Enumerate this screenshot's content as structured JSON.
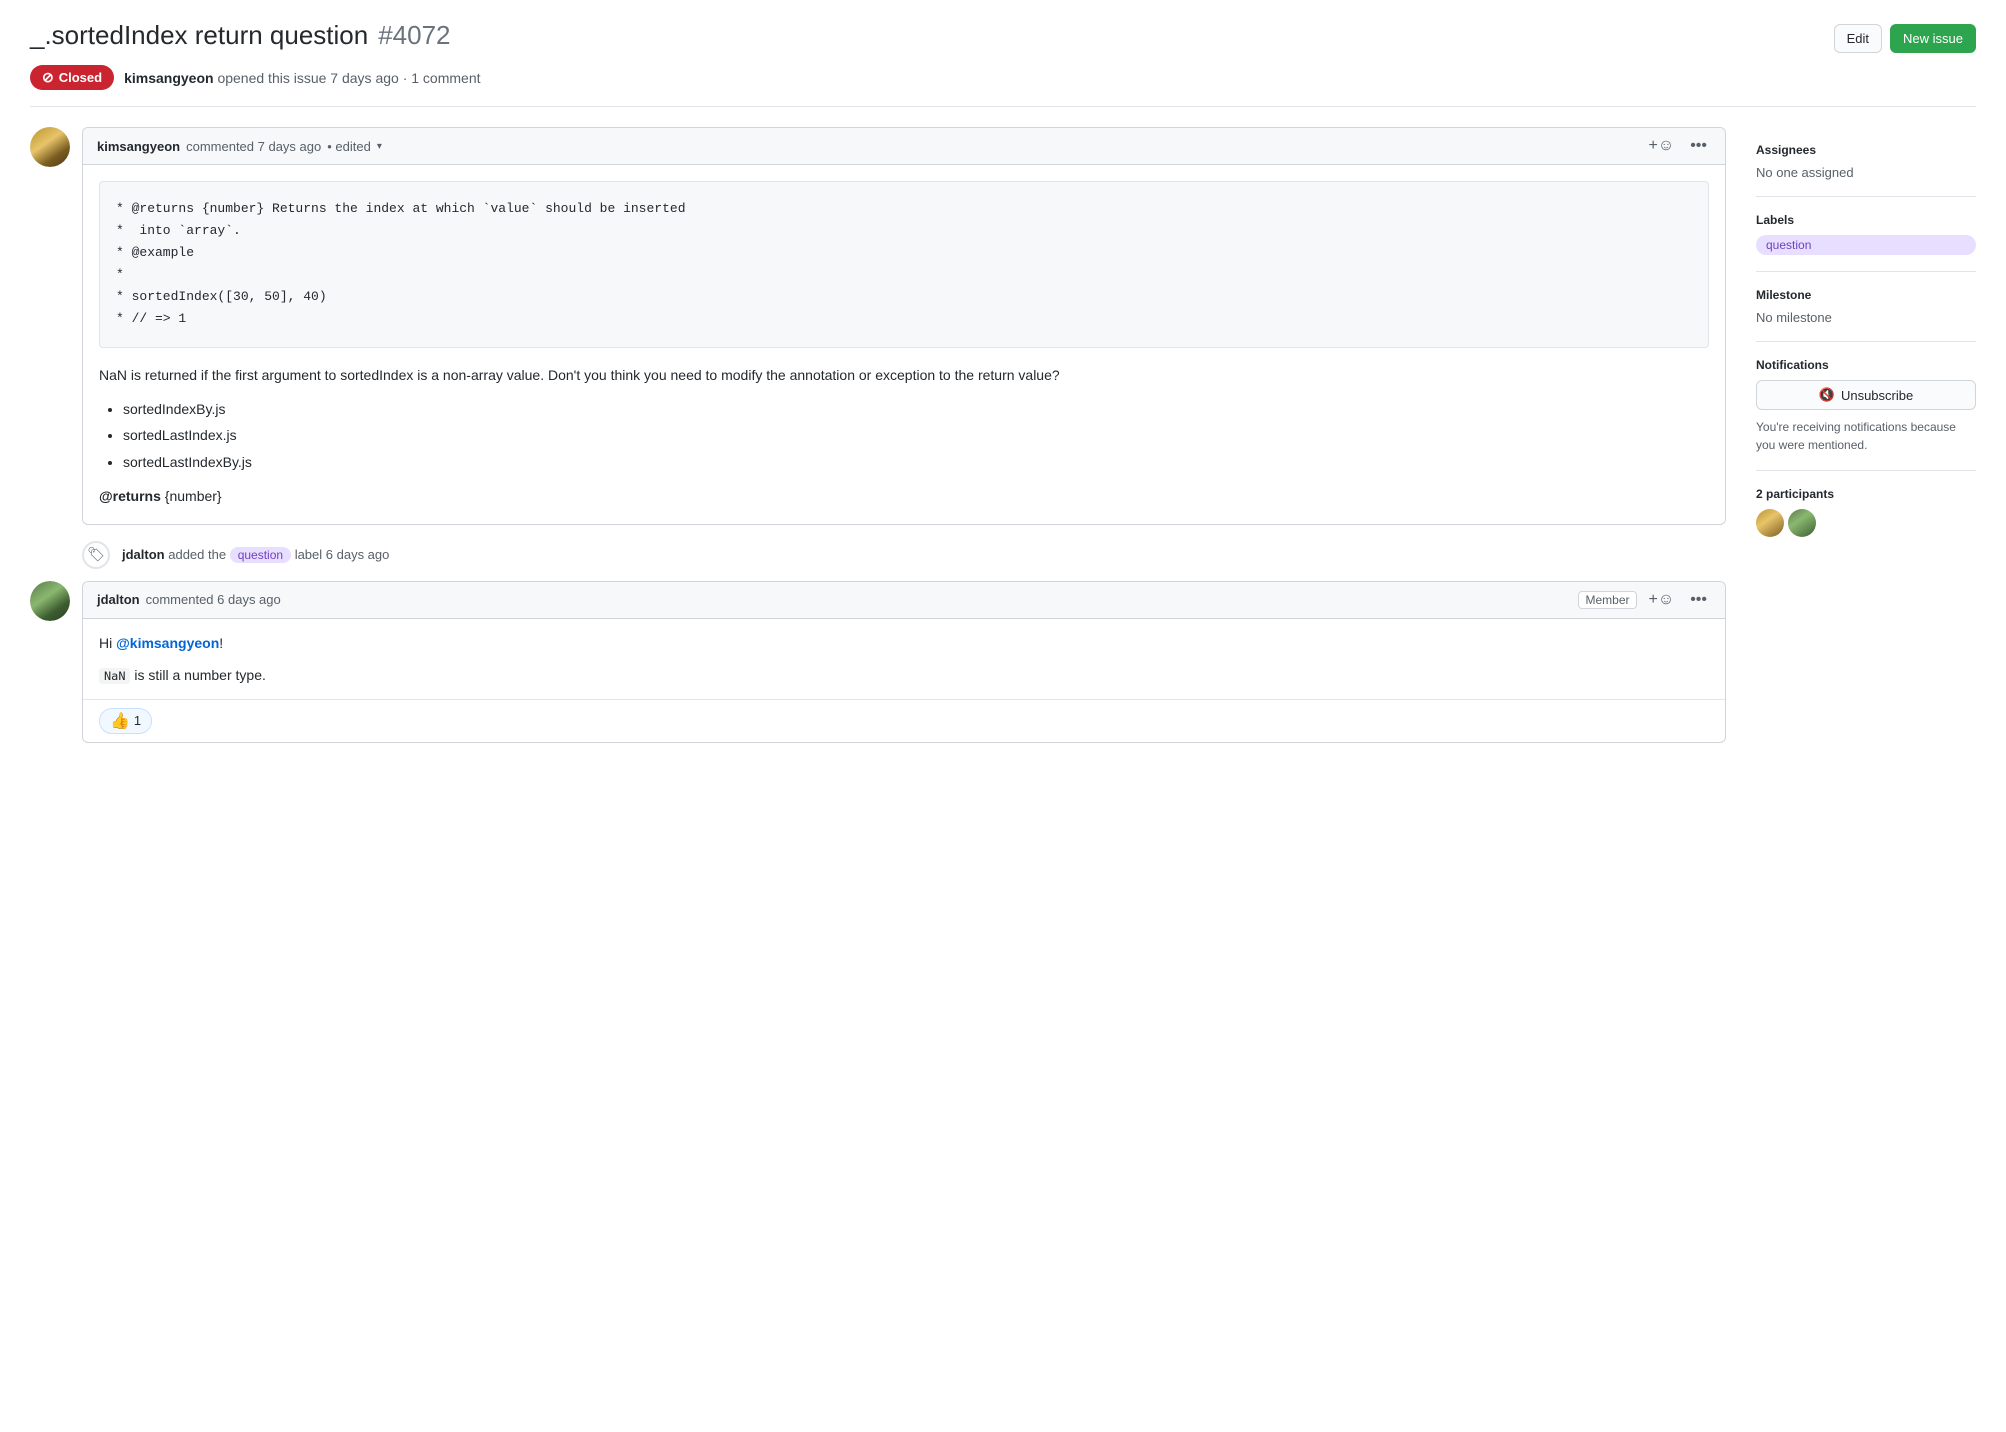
{
  "header": {
    "title": "_.sortedIndex return question",
    "issue_number": "#4072",
    "edit_label": "Edit",
    "new_issue_label": "New issue"
  },
  "status": {
    "badge": "Closed",
    "meta": "kimsangyeon opened this issue 7 days ago · 1 comment"
  },
  "first_comment": {
    "author": "kimsangyeon",
    "time": "commented 7 days ago",
    "edited": "• edited",
    "code_lines": [
      "* @returns {number} Returns the index at which `value` should be inserted",
      "*  into `array`.",
      "* @example",
      "*",
      "* sortedIndex([30, 50], 40)",
      "* // => 1"
    ],
    "body_text": "NaN is returned if the first argument to sortedIndex is a non-array value. Don't you think you need to modify the annotation or exception to the return value?",
    "bullets": [
      "sortedIndexBy.js",
      "sortedLastIndex.js",
      "sortedLastIndexBy.js"
    ],
    "returns_line_bold": "@returns",
    "returns_line_rest": " {number}"
  },
  "timeline_event": {
    "author": "jdalton",
    "action": "added the",
    "label": "question",
    "suffix": "label 6 days ago"
  },
  "second_comment": {
    "author": "jdalton",
    "time": "commented 6 days ago",
    "member_badge": "Member",
    "greeting": "Hi ",
    "mention": "@kimsangyeon",
    "greeting_end": "!",
    "body_part1": "is still a number type.",
    "nan_code": "NaN",
    "reaction_emoji": "👍",
    "reaction_count": "1"
  },
  "sidebar": {
    "assignees_heading": "Assignees",
    "assignees_value": "No one assigned",
    "labels_heading": "Labels",
    "label_value": "question",
    "milestone_heading": "Milestone",
    "milestone_value": "No milestone",
    "notifications_heading": "Notifications",
    "unsubscribe_label": "🔇 Unsubscribe",
    "notification_text": "You're receiving notifications because you were mentioned.",
    "participants_heading": "2 participants"
  },
  "icons": {
    "closed_icon": "⊘",
    "tag_icon": "🏷",
    "emoji_icon": "☺",
    "dots_icon": "···",
    "unsubscribe_icon": "🔇"
  }
}
